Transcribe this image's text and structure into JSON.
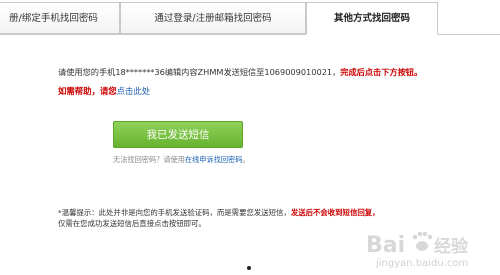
{
  "tabs": [
    {
      "label": "册/绑定手机找回密码"
    },
    {
      "label": "通过登录/注册邮箱找回密码"
    },
    {
      "label": "其他方式找回密码"
    }
  ],
  "instruction": {
    "text": "请使用您的手机18*******36编辑内容ZHMM发送短信至1069009010021，",
    "emphasis": "完成后点击下方按钮。"
  },
  "help": {
    "need": "如需帮助，请您",
    "link": "点击此处"
  },
  "send_button": {
    "label": "我已发送短信"
  },
  "hint": {
    "text": "无法找回密码？请使用",
    "link": "在线申诉找回密码",
    "end": "。"
  },
  "warning": {
    "line1": "*温馨提示：此处并非是向您的手机发送验证码，而是需要您发送短信，",
    "line1_red": "发送后不会收到短信回复，",
    "line2": "仅需在您成功发送短信后直接点击按钮即可。"
  },
  "watermark": {
    "brand": "Bai",
    "brand2": "经验",
    "sub": "jingyan.baidu.com"
  }
}
